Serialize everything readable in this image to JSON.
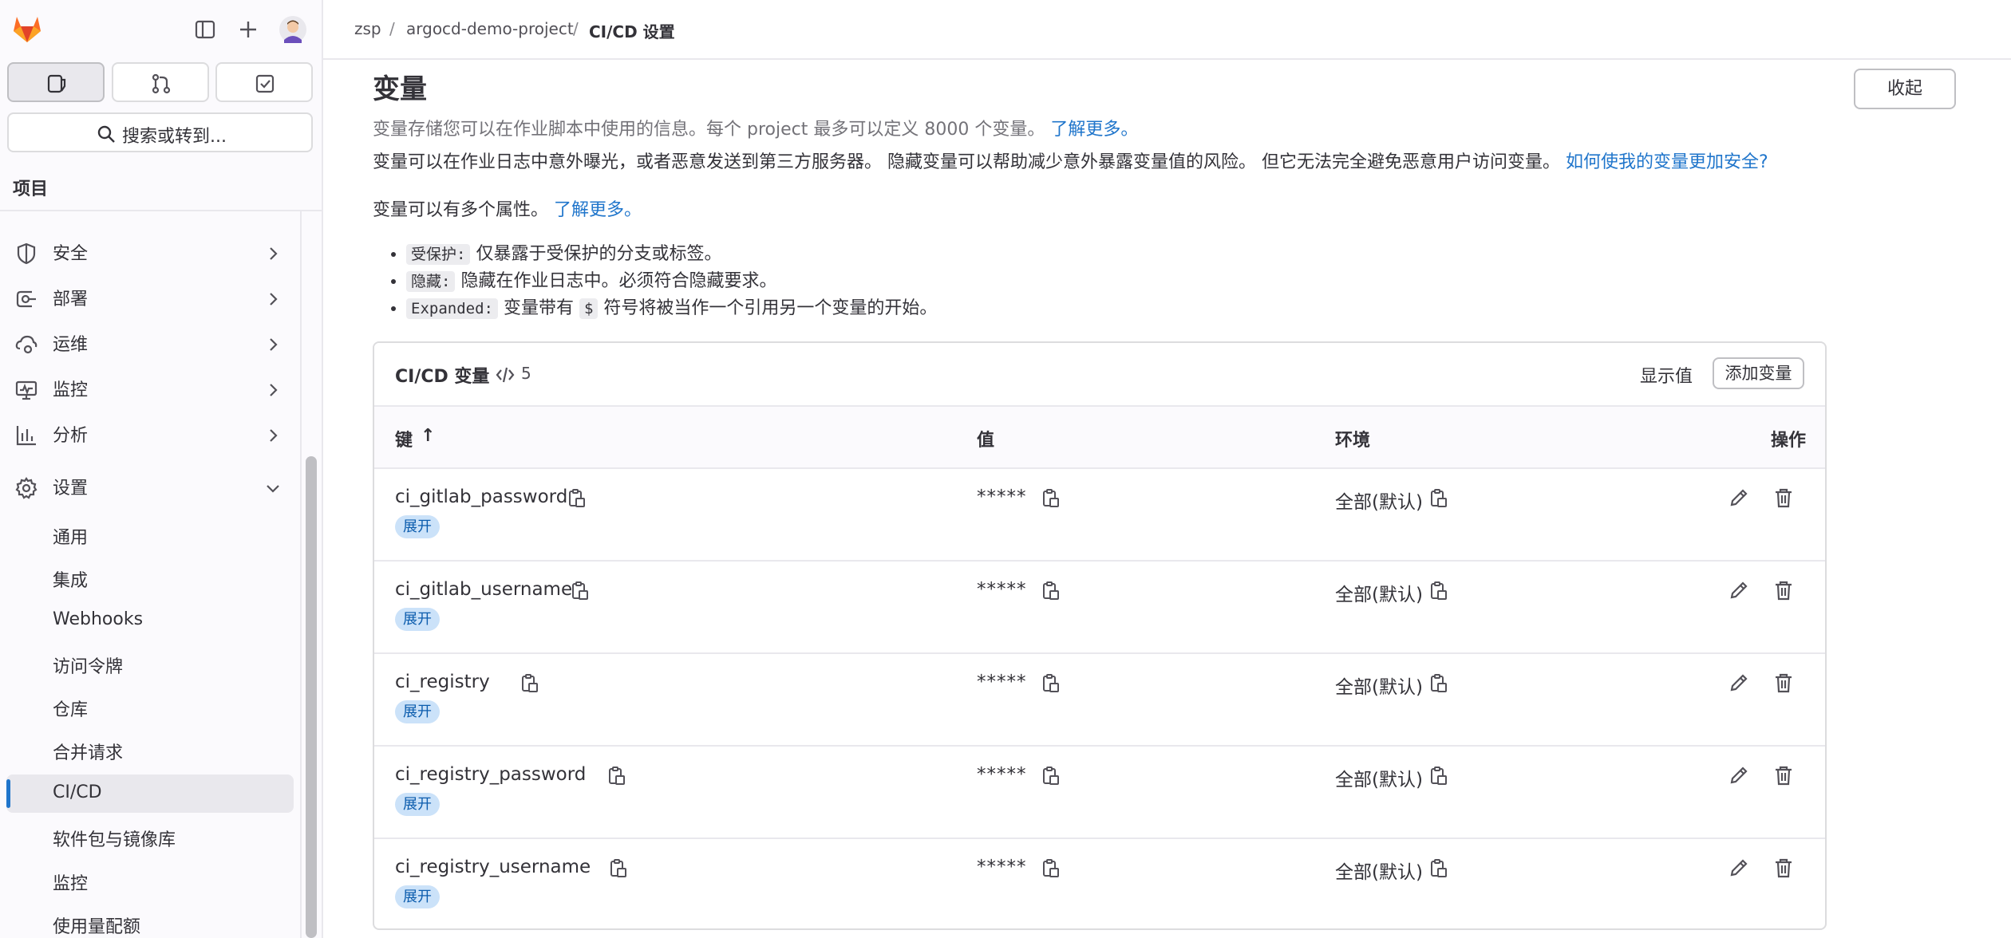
{
  "sidebar": {
    "search_label": "搜索或转到...",
    "section_title": "项目",
    "nav_items": [
      {
        "label": "安全",
        "icon": "shield-icon"
      },
      {
        "label": "部署",
        "icon": "deployments-icon"
      },
      {
        "label": "运维",
        "icon": "cloud-gear-icon"
      },
      {
        "label": "监控",
        "icon": "monitor-icon"
      },
      {
        "label": "分析",
        "icon": "chart-icon"
      },
      {
        "label": "设置",
        "icon": "gear-icon"
      }
    ],
    "settings_items": [
      "通用",
      "集成",
      "Webhooks",
      "访问令牌",
      "仓库",
      "合并请求",
      "CI/CD",
      "软件包与镜像库",
      "监控",
      "使用量配额"
    ],
    "active_item": "CI/CD"
  },
  "breadcrumb": [
    "zsp",
    "argocd-demo-project",
    "CI/CD 设置"
  ],
  "section": {
    "title": "变量",
    "collapse_label": "收起",
    "description": "变量存储您可以在作业脚本中使用的信息。每个 project 最多可以定义 8000 个变量。",
    "learn_more": "了解更多。",
    "warning": "变量可以在作业日志中意外曝光，或者恶意发送到第三方服务器。 隐藏变量可以帮助减少意外暴露变量值的风险。 但它无法完全避免恶意用户访问变量。",
    "security_link": "如何使我的变量更加安全?",
    "attributes_intro": "变量可以有多个属性。",
    "attributes_link": "了解更多。",
    "attributes": [
      {
        "code": "受保护:",
        "text": "仅暴露于受保护的分支或标签。"
      },
      {
        "code": "隐藏:",
        "text": "隐藏在作业日志中。必须符合隐藏要求。"
      },
      {
        "code": "Expanded:",
        "text_before": "变量带有",
        "code2": "$",
        "text_after": "符号将被当作一个引用另一个变量的开始。"
      }
    ]
  },
  "variables_card": {
    "title": "CI/CD 变量",
    "count": "5",
    "reveal_label": "显示值",
    "add_label": "添加变量",
    "columns": {
      "key": "键",
      "value": "值",
      "env": "环境",
      "actions": "操作"
    },
    "sort_arrow": "↑",
    "rows": [
      {
        "key": "ci_gitlab_password",
        "badge": "展开",
        "value": "*****",
        "env": "全部(默认)"
      },
      {
        "key": "ci_gitlab_username",
        "badge": "展开",
        "value": "*****",
        "env": "全部(默认)"
      },
      {
        "key": "ci_registry",
        "badge": "展开",
        "value": "*****",
        "env": "全部(默认)"
      },
      {
        "key": "ci_registry_password",
        "badge": "展开",
        "value": "*****",
        "env": "全部(默认)"
      },
      {
        "key": "ci_registry_username",
        "badge": "展开",
        "value": "*****",
        "env": "全部(默认)"
      }
    ]
  },
  "colors": {
    "brand_orange": "#e24329",
    "link": "#1f75cb",
    "active_bar": "#1f75cb",
    "badge_bg": "#cbe2f9"
  }
}
